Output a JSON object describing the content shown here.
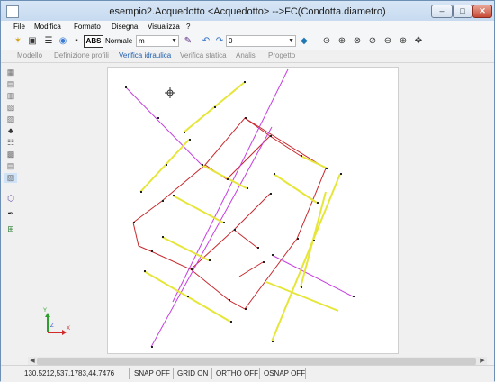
{
  "window": {
    "title": "esempio2.Acquedotto <Acquedotto> -->FC(Condotta.diametro)",
    "controls": {
      "minimize": "–",
      "maximize": "□",
      "close": "✕"
    }
  },
  "menu": [
    "File",
    "Modifica",
    "Formato",
    "Disegna",
    "Visualizza",
    "?"
  ],
  "toolbar": {
    "abs_label": "ABS",
    "style_label": "Normale",
    "unit_value": "m",
    "layer_value": "0",
    "icons": [
      "pointer-icon",
      "snap-icon",
      "layer-icon",
      "palette-icon",
      "save-icon",
      "line-color-icon",
      "undo-icon",
      "redo-icon",
      "zoom-window-icon",
      "zoom-all-icon",
      "zoom-previous-icon",
      "zoom-extents-icon",
      "zoom-out-icon",
      "zoom-in-icon",
      "pan-icon"
    ]
  },
  "tabs": [
    {
      "label": "Modello",
      "active": false
    },
    {
      "label": "Definizione profili",
      "active": false
    },
    {
      "label": "Verifica idraulica",
      "active": true
    },
    {
      "label": "Verifica statica",
      "active": false
    },
    {
      "label": "Analisi",
      "active": false
    },
    {
      "label": "Progetto",
      "active": false
    }
  ],
  "status": {
    "coords": "130.5212,537.1783,44.7476",
    "snap": "SNAP OFF",
    "grid": "GRID ON",
    "ortho": "ORTHO OFF",
    "osnap": "OSNAP OFF"
  },
  "axes": {
    "x": "X",
    "y": "Y",
    "z": "Z"
  },
  "colors": {
    "main_red": "#c8282d",
    "magenta": "#c63fe0",
    "yellow": "#e6e63a",
    "node": "#222222",
    "accent_tab": "#1f5fb0"
  }
}
